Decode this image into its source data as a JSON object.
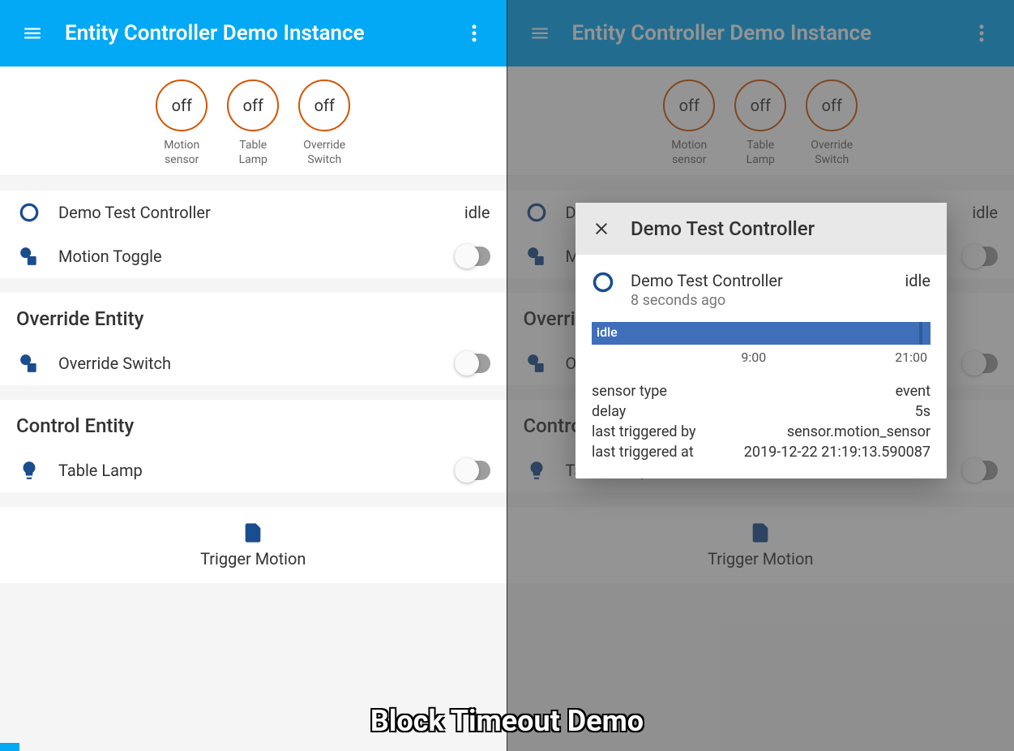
{
  "header": {
    "title": "Entity Controller Demo Instance"
  },
  "glance": {
    "items": [
      {
        "state": "off",
        "label1": "Motion",
        "label2": "sensor"
      },
      {
        "state": "off",
        "label1": "Table",
        "label2": "Lamp"
      },
      {
        "state": "off",
        "label1": "Override",
        "label2": "Switch"
      }
    ]
  },
  "entities": {
    "controller": {
      "name": "Demo Test Controller",
      "state": "idle"
    },
    "motion_toggle": {
      "name": "Motion Toggle"
    }
  },
  "override_card": {
    "title": "Override Entity",
    "switch": {
      "name": "Override Switch"
    }
  },
  "control_card": {
    "title": "Control Entity",
    "lamp": {
      "name": "Table Lamp"
    }
  },
  "script": {
    "label": "Trigger Motion"
  },
  "dialog": {
    "title": "Demo Test Controller",
    "entity_name": "Demo Test Controller",
    "entity_sub": "8 seconds ago",
    "entity_state": "idle",
    "history_label": "idle",
    "time_a": "9:00",
    "time_b": "21:00",
    "attrs": [
      {
        "k": "sensor type",
        "v": "event"
      },
      {
        "k": "delay",
        "v": "5s"
      },
      {
        "k": "last triggered by",
        "v": "sensor.motion_sensor"
      },
      {
        "k": "last triggered at",
        "v": "2019-12-22 21:19:13.590087"
      }
    ]
  },
  "footer": "Block Timeout Demo"
}
